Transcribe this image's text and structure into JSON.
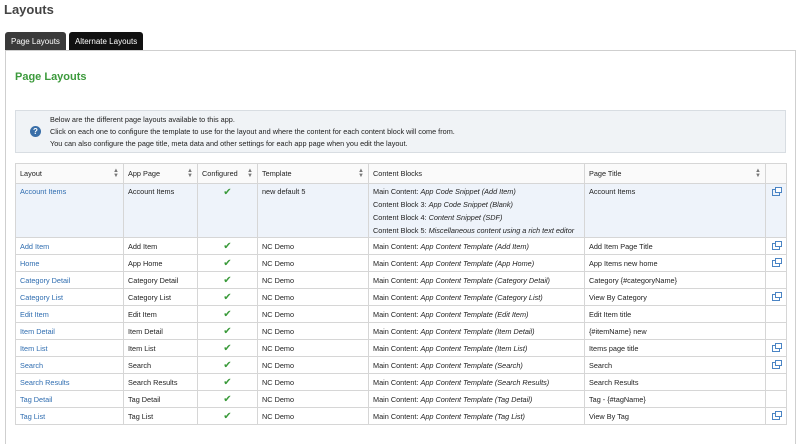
{
  "page_title": "Layouts",
  "tabs": [
    {
      "label": "Page Layouts",
      "active": false
    },
    {
      "label": "Alternate Layouts",
      "active": true
    }
  ],
  "panel_title": "Page Layouts",
  "info_lines": [
    "Below are the different page layouts available to this app.",
    "Click on each one to configure the template to use for the layout and where the content for each content block will come from.",
    "You can also configure the page title, meta data and other settings for each app page when you edit the layout."
  ],
  "columns": [
    "Layout",
    "App Page",
    "Configured",
    "Template",
    "Content Blocks",
    "Page Title"
  ],
  "rows": [
    {
      "layout": "Account Items",
      "app_page": "Account Items",
      "configured": true,
      "template": "new default 5",
      "blocks": [
        {
          "label": "Main Content: ",
          "value": "App Code Snippet (Add Item)"
        },
        {
          "label": "Content Block 3: ",
          "value": "App Code Snippet (Blank)"
        },
        {
          "label": "Content Block 4: ",
          "value": "Content Snippet (SDF)"
        },
        {
          "label": "Content Block 5: ",
          "value": "Miscellaneous content using a rich text editor"
        }
      ],
      "page_title": "Account Items",
      "link": true
    },
    {
      "layout": "Add Item",
      "app_page": "Add Item",
      "configured": true,
      "template": "NC Demo",
      "blocks": [
        {
          "label": "Main Content: ",
          "value": "App Content Template (Add Item)"
        }
      ],
      "page_title": "Add Item Page Title",
      "link": true
    },
    {
      "layout": "Home",
      "app_page": "App Home",
      "configured": true,
      "template": "NC Demo",
      "blocks": [
        {
          "label": "Main Content: ",
          "value": "App Content Template (App Home)"
        }
      ],
      "page_title": "App Items new home",
      "link": true
    },
    {
      "layout": "Category Detail",
      "app_page": "Category Detail",
      "configured": true,
      "template": "NC Demo",
      "blocks": [
        {
          "label": "Main Content: ",
          "value": "App Content Template (Category Detail)"
        }
      ],
      "page_title": "Category {#categoryName}",
      "link": false
    },
    {
      "layout": "Category List",
      "app_page": "Category List",
      "configured": true,
      "template": "NC Demo",
      "blocks": [
        {
          "label": "Main Content: ",
          "value": "App Content Template (Category List)"
        }
      ],
      "page_title": "View By Category",
      "link": true
    },
    {
      "layout": "Edit Item",
      "app_page": "Edit Item",
      "configured": true,
      "template": "NC Demo",
      "blocks": [
        {
          "label": "Main Content: ",
          "value": "App Content Template (Edit Item)"
        }
      ],
      "page_title": "Edit Item title",
      "link": false
    },
    {
      "layout": "Item Detail",
      "app_page": "Item Detail",
      "configured": true,
      "template": "NC Demo",
      "blocks": [
        {
          "label": "Main Content: ",
          "value": "App Content Template (Item Detail)"
        }
      ],
      "page_title": "{#itemName} new",
      "link": false
    },
    {
      "layout": "Item List",
      "app_page": "Item List",
      "configured": true,
      "template": "NC Demo",
      "blocks": [
        {
          "label": "Main Content: ",
          "value": "App Content Template (Item List)"
        }
      ],
      "page_title": "Items page title",
      "link": true
    },
    {
      "layout": "Search",
      "app_page": "Search",
      "configured": true,
      "template": "NC Demo",
      "blocks": [
        {
          "label": "Main Content: ",
          "value": "App Content Template (Search)"
        }
      ],
      "page_title": "Search",
      "link": true
    },
    {
      "layout": "Search Results",
      "app_page": "Search Results",
      "configured": true,
      "template": "NC Demo",
      "blocks": [
        {
          "label": "Main Content: ",
          "value": "App Content Template (Search Results)"
        }
      ],
      "page_title": "Search Results",
      "link": false
    },
    {
      "layout": "Tag Detail",
      "app_page": "Tag Detail",
      "configured": true,
      "template": "NC Demo",
      "blocks": [
        {
          "label": "Main Content: ",
          "value": "App Content Template (Tag Detail)"
        }
      ],
      "page_title": "Tag - {#tagName}",
      "link": false
    },
    {
      "layout": "Tag List",
      "app_page": "Tag List",
      "configured": true,
      "template": "NC Demo",
      "blocks": [
        {
          "label": "Main Content: ",
          "value": "App Content Template (Tag List)"
        }
      ],
      "page_title": "View By Tag",
      "link": true
    }
  ],
  "icons": {
    "configured": "checkmark-icon",
    "link": "external-link-icon",
    "info": "info-icon"
  },
  "colors": {
    "title_green": "#3c9a3c",
    "link_blue": "#2f6db0",
    "highlight_row": "#eef3fa",
    "active_tab": "#111111"
  }
}
